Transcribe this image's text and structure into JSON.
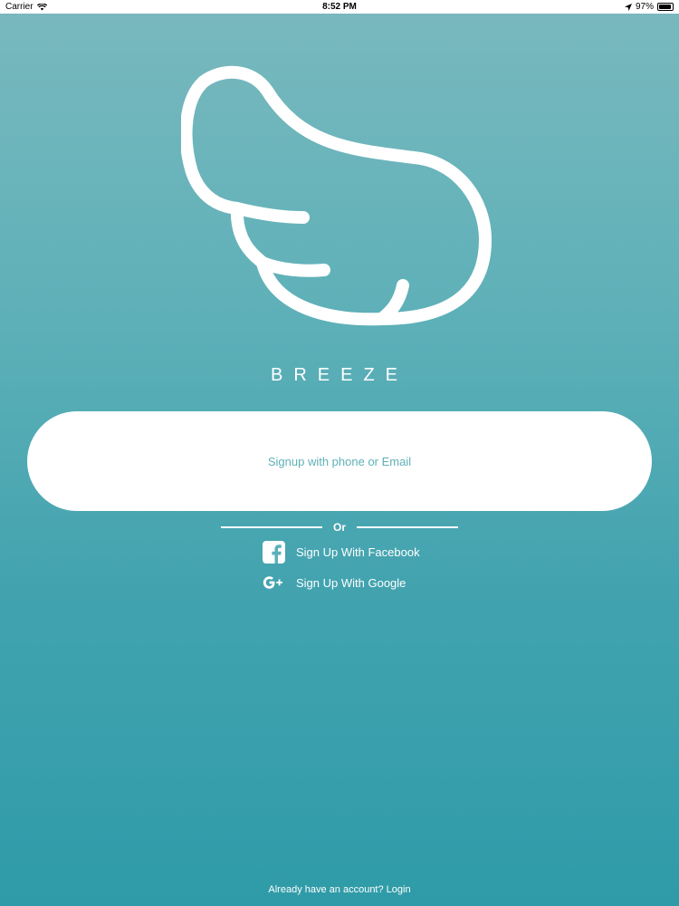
{
  "status_bar": {
    "carrier": "Carrier",
    "time": "8:52 PM",
    "battery": "97%"
  },
  "logo": {
    "icon": "wing-logo-icon",
    "color": "#ffffff"
  },
  "brand": {
    "name": "BREEZE"
  },
  "signup": {
    "label": "Signup with phone or Email"
  },
  "divider": {
    "label": "Or"
  },
  "social": {
    "facebook_label": "Sign Up With Facebook",
    "google_label": "Sign Up With Google"
  },
  "footer": {
    "login_prompt": "Already have an account? Login"
  },
  "colors": {
    "gradient_top": "#79b9be",
    "gradient_bottom": "#2f9ba8",
    "button_text": "#5fb0b6"
  }
}
